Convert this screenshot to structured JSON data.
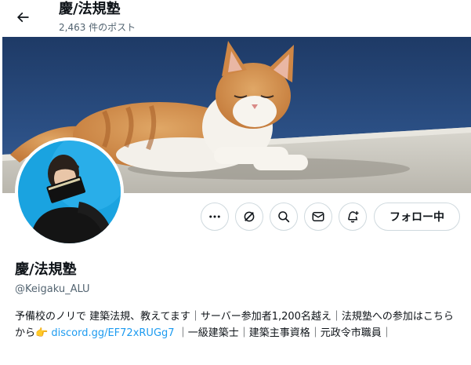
{
  "header": {
    "title": "慶/法規塾",
    "post_count": "2,463 件のポスト"
  },
  "profile": {
    "display_name": "慶/法規塾",
    "handle": "@Keigaku_ALU",
    "bio": {
      "text_before": "予備校のノリで 建築法規、教えてます｜サーバー参加者1,200名越え｜法規塾への参加はこちらから",
      "emoji": "👉",
      "link": "discord.gg/EF72xRUGg7",
      "text_after": "｜一級建築士｜建築主事資格｜元政令市職員｜"
    }
  },
  "actions": {
    "follow_label": "フォロー中",
    "icons": [
      "more-icon",
      "grok-icon",
      "search-icon",
      "message-icon",
      "notify-add-icon"
    ]
  },
  "colors": {
    "link": "#1d9bf0",
    "secondary_text": "#536471",
    "border": "#cfd9de",
    "avatar_bg": "#1aa3e0"
  }
}
